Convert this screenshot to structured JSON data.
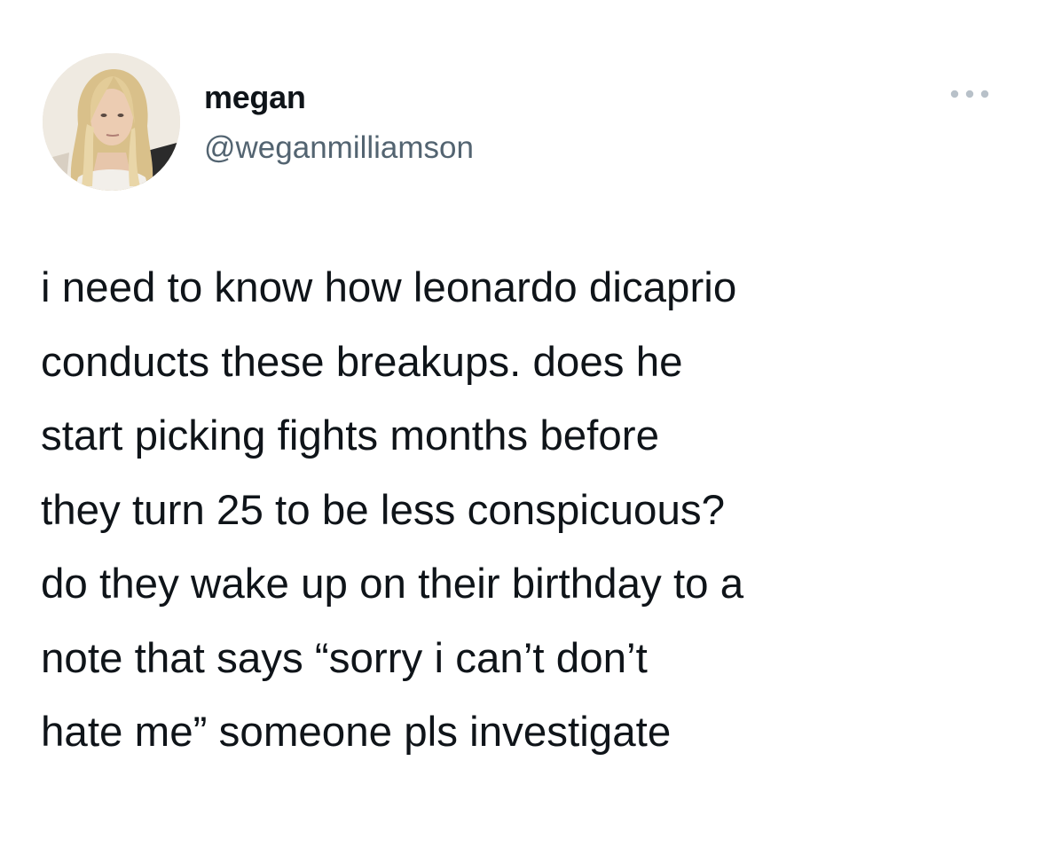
{
  "tweet": {
    "author": {
      "display_name": "megan",
      "handle": "@weganmilliamson",
      "avatar_icon": "profile-photo"
    },
    "more_icon": "more-horizontal-icon",
    "text_lines": [
      "i need to know how leonardo dicaprio",
      "conducts these breakups. does he",
      "start picking fights months before",
      "they turn 25 to be less conspicuous?",
      "do they wake up on their birthday to a",
      "note that says “sorry i can’t don’t",
      "hate me” someone pls investigate"
    ]
  },
  "colors": {
    "text_primary": "#0f1419",
    "text_secondary": "#536471",
    "background": "#ffffff"
  }
}
